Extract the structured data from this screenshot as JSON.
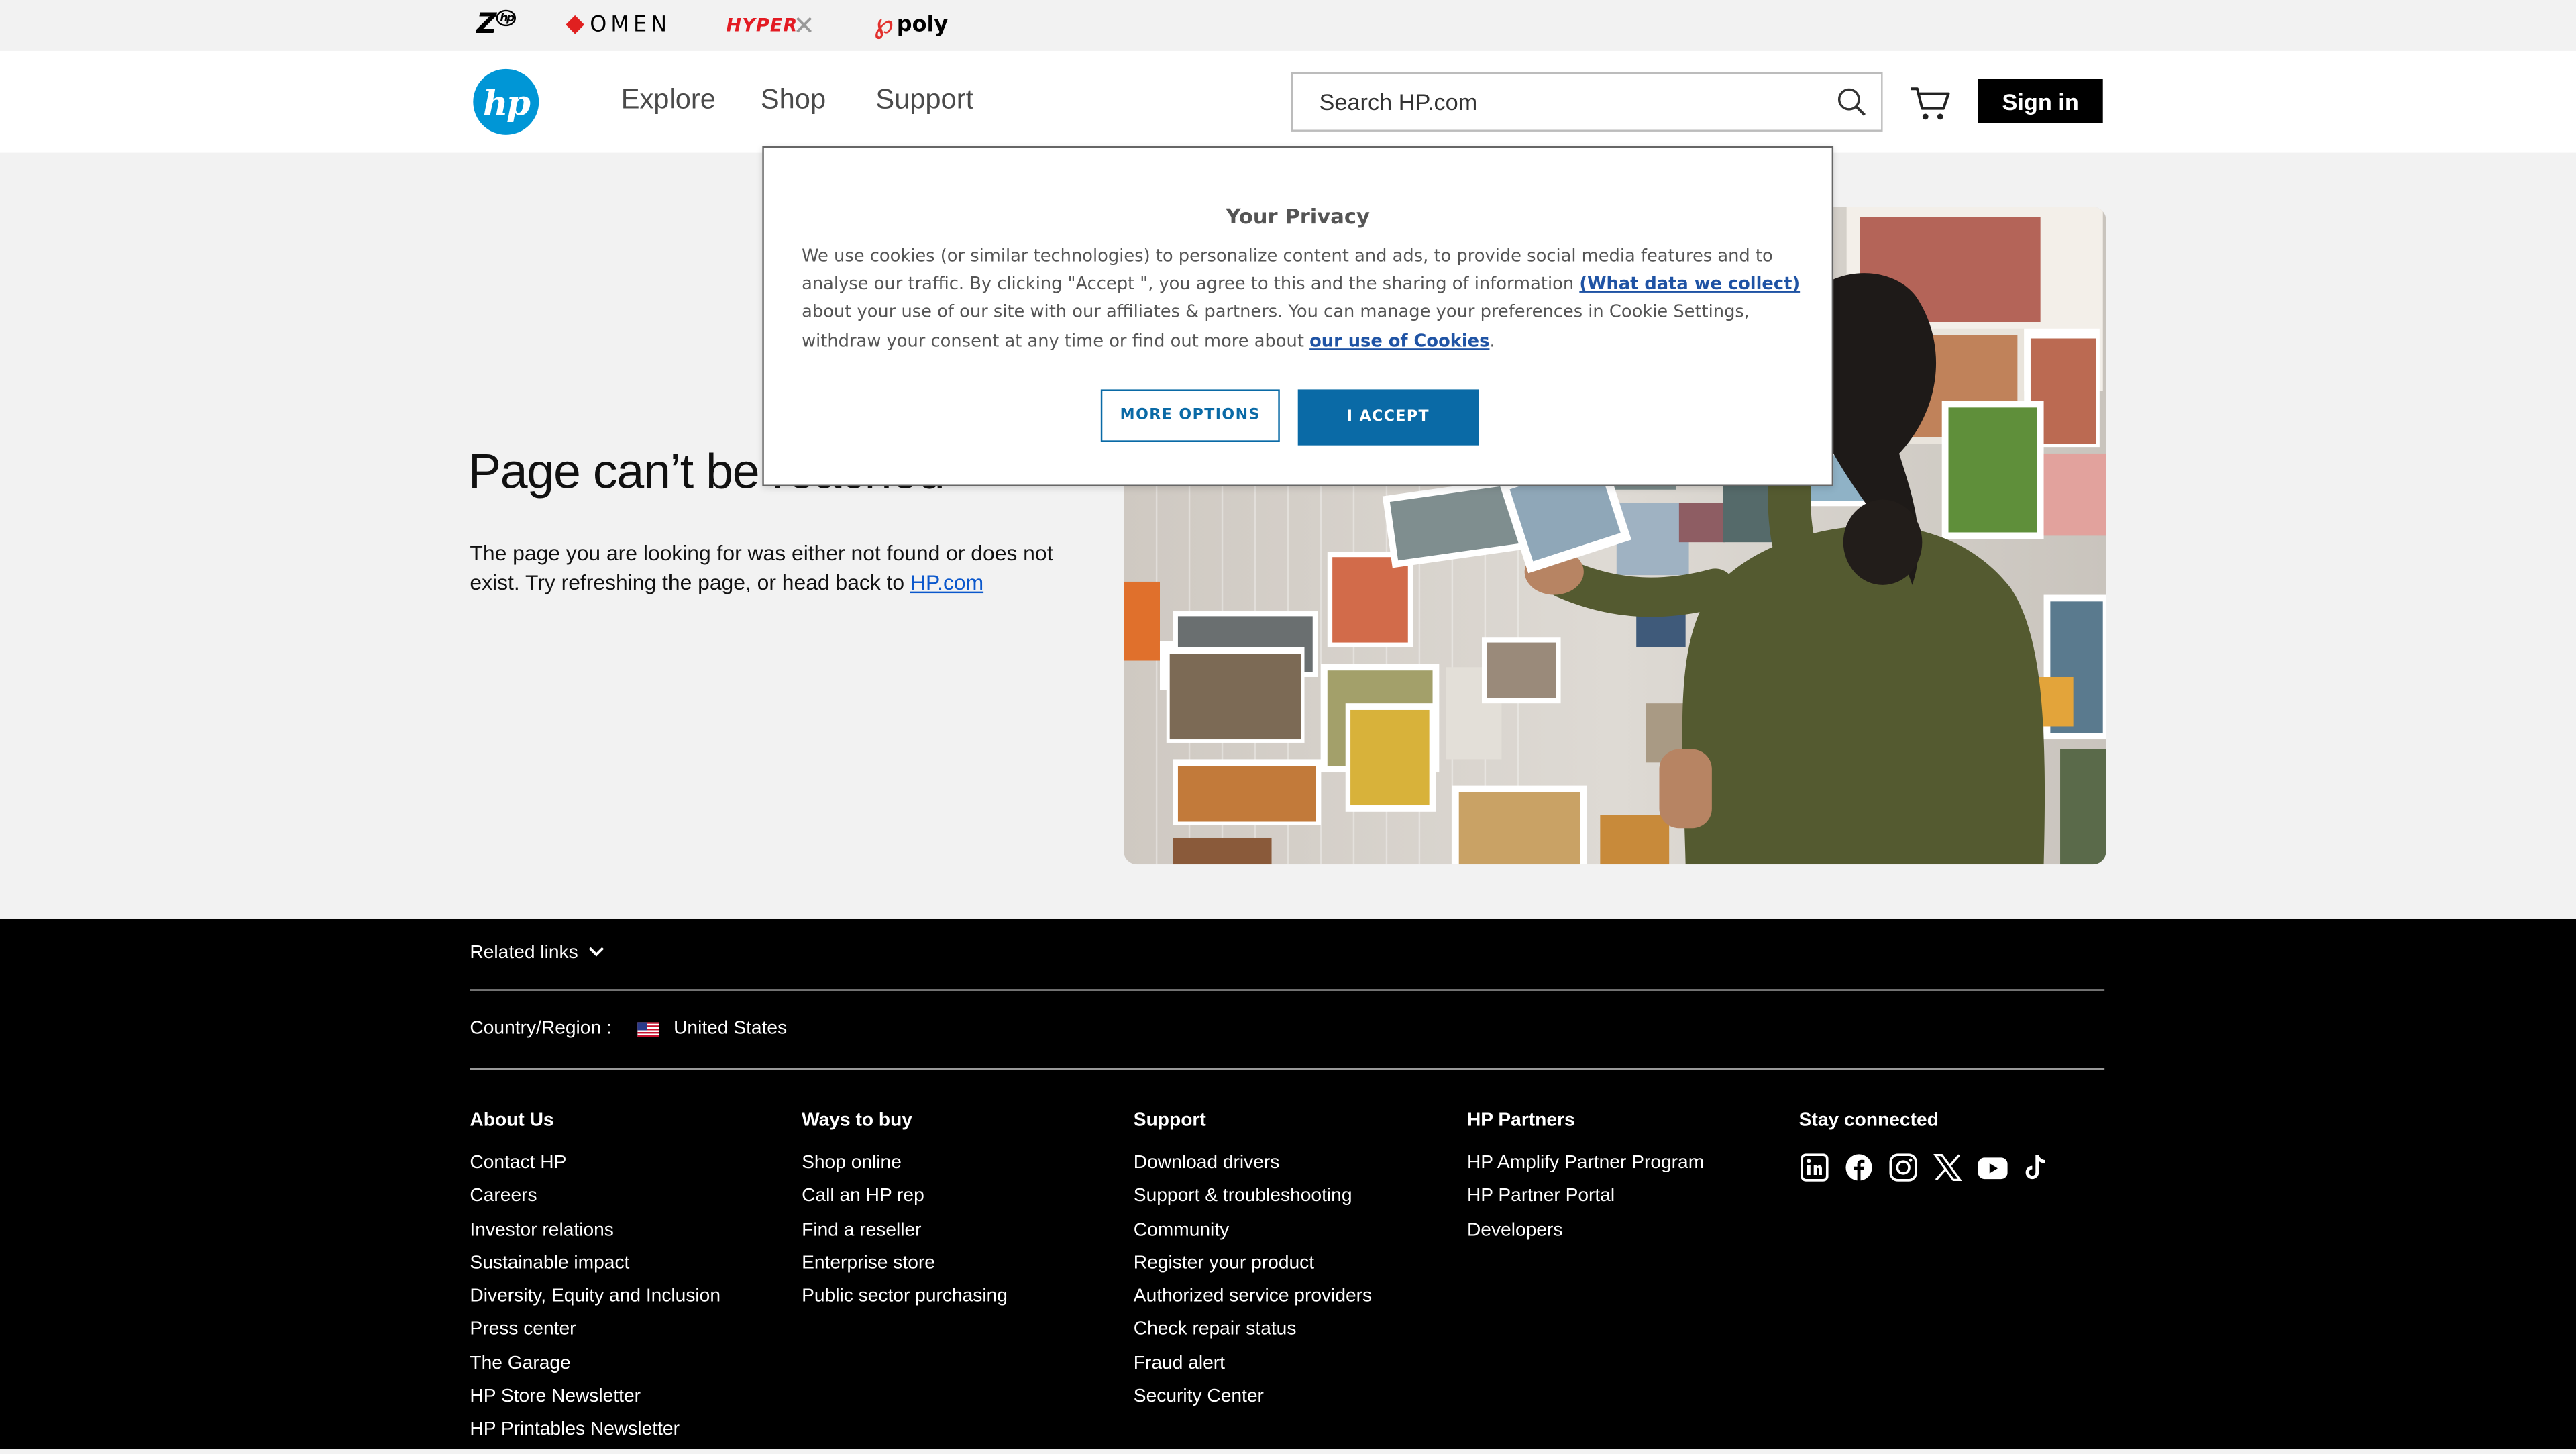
{
  "brands": {
    "z": "Z",
    "omen": "OMEN",
    "hyperx": "HYPER",
    "poly": "poly"
  },
  "header": {
    "logo": "hp",
    "nav": [
      "Explore",
      "Shop",
      "Support"
    ],
    "search_placeholder": "Search HP.com",
    "sign_in": "Sign in"
  },
  "main": {
    "title": "Page can’t be reached",
    "message": "The page you are looking for was either not found or does not exist. Try refreshing the page, or head back to ",
    "link": "HP.com"
  },
  "privacy": {
    "title": "Your Privacy",
    "text_1": "We use cookies (or similar technologies) to personalize content and ads, to provide social media features and to analyse our traffic. By clicking \"Accept \", you agree to this and the sharing of information ",
    "link_1": "(What data we collect)",
    "text_2": " about your use of our site with our affiliates & partners. You can manage your preferences in Cookie Settings, withdraw your consent at any time or find out more about ",
    "link_2": "our use of Cookies",
    "text_3": ".",
    "more_options": "MORE OPTIONS",
    "accept": "I ACCEPT"
  },
  "footer": {
    "related_links": "Related links",
    "country_label": "Country/Region :",
    "country_value": "United States",
    "columns": [
      {
        "heading": "About Us",
        "links": [
          "Contact HP",
          "Careers",
          "Investor relations",
          "Sustainable impact",
          "Diversity, Equity and Inclusion",
          "Press center",
          "The Garage",
          "HP Store Newsletter",
          "HP Printables Newsletter"
        ]
      },
      {
        "heading": "Ways to buy",
        "links": [
          "Shop online",
          "Call an HP rep",
          "Find a reseller",
          "Enterprise store",
          "Public sector purchasing"
        ]
      },
      {
        "heading": "Support",
        "links": [
          "Download drivers",
          "Support & troubleshooting",
          "Community",
          "Register your product",
          "Authorized service providers",
          "Check repair status",
          "Fraud alert",
          "Security Center"
        ]
      },
      {
        "heading": "HP Partners",
        "links": [
          "HP Amplify Partner Program",
          "HP Partner Portal",
          "Developers"
        ]
      },
      {
        "heading": "Stay connected",
        "links": []
      }
    ],
    "social_icons": [
      "linkedin-icon",
      "facebook-icon",
      "instagram-icon",
      "x-icon",
      "youtube-icon",
      "tiktok-icon"
    ]
  },
  "colors": {
    "hp_blue": "#0096d6",
    "accept_blue": "#0a6aa6",
    "link_blue": "#0a57cc",
    "footer_bg": "#000000",
    "page_bg": "#f2f2f2"
  }
}
